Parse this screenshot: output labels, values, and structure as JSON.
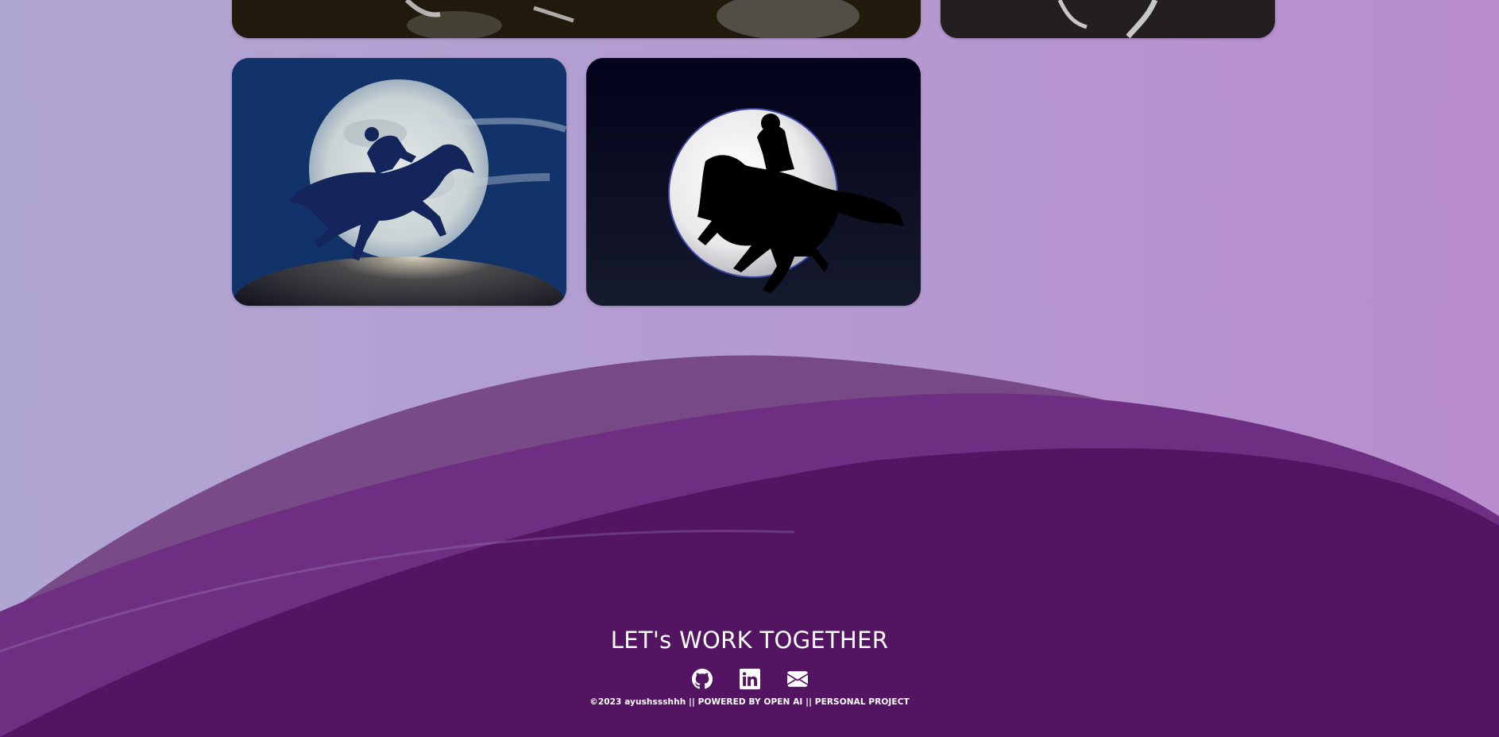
{
  "gallery": {
    "images": [
      {
        "name": "landscape-image-partial",
        "icon": "image-placeholder"
      },
      {
        "name": "figure-image-partial",
        "icon": "image-placeholder"
      },
      {
        "name": "rider-moon-blue",
        "icon": "horse-rider-silhouette"
      },
      {
        "name": "horse-moon-dark",
        "icon": "horse-rider-silhouette"
      }
    ]
  },
  "footer": {
    "heading": "LET's WORK TOGETHER",
    "social": [
      {
        "label": "GitHub",
        "icon": "github-icon"
      },
      {
        "label": "LinkedIn",
        "icon": "linkedin-icon"
      },
      {
        "label": "Email",
        "icon": "envelope-icon"
      }
    ],
    "copyright": "©2023 ayushssshhh || POWERED BY OPEN AI || PERSONAL PROJECT"
  },
  "colors": {
    "background_left": "#b0a6d3",
    "background_right": "#b98ccf",
    "wave_dark": "#531461",
    "wave_mid": "#6e2e82",
    "wave_light": "#734280"
  }
}
